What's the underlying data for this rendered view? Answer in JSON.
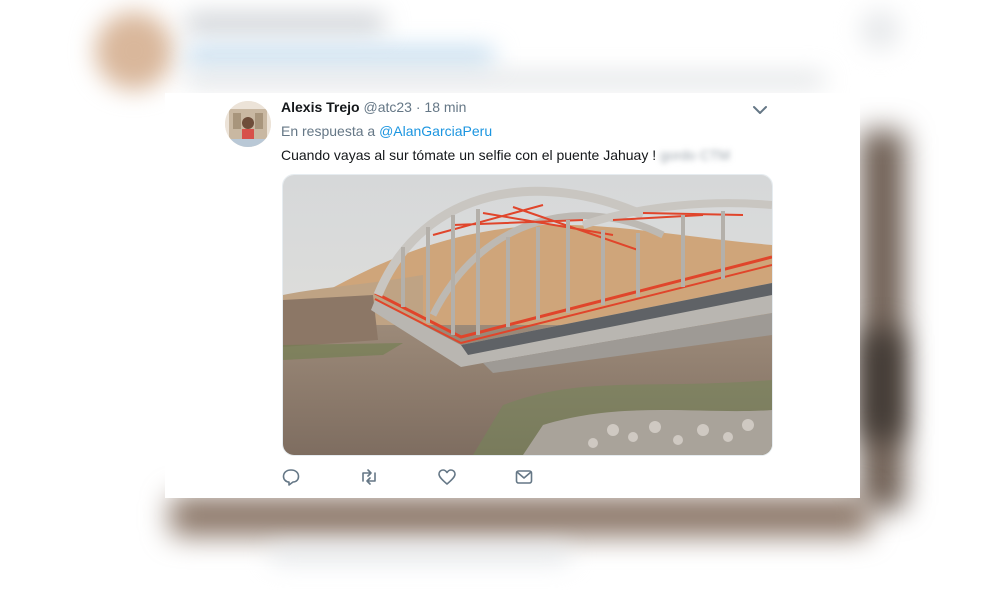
{
  "tweet": {
    "display_name": "Alexis Trejo",
    "handle": "@atc23",
    "separator": "·",
    "time": "18 min",
    "reply_prefix": "En respuesta a",
    "reply_mention": "@AlanGarciaPeru",
    "text": "Cuando vayas al sur tómate un selfie con el puente Jahuay !",
    "text_blurred": "gordo CTM",
    "media": {
      "description": "collapsed-arch-bridge-photo"
    },
    "actions": {
      "reply_icon": "reply-icon",
      "retweet_icon": "retweet-icon",
      "like_icon": "heart-icon",
      "message_icon": "direct-message-icon"
    }
  },
  "colors": {
    "link": "#1b95e0",
    "text": "#14171a",
    "secondary": "#657786",
    "bridge_railing": "#e0452b"
  }
}
